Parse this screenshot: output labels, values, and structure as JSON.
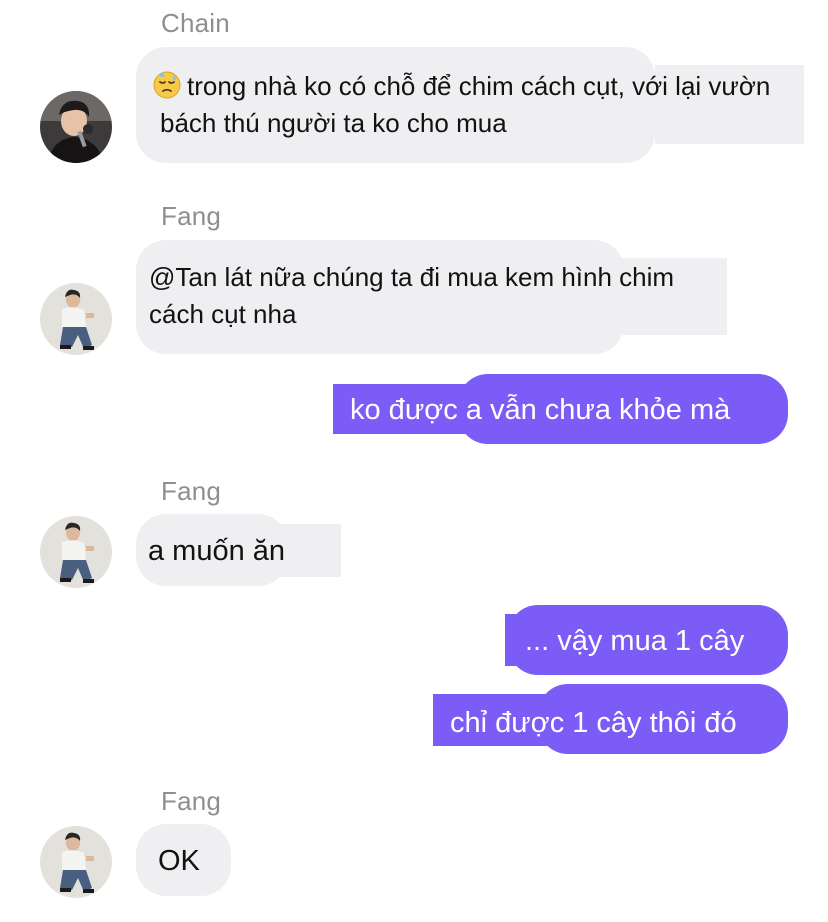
{
  "colors": {
    "incoming_bubble": "#efeff2",
    "outgoing_bubble": "#7b5cf6",
    "sender_name": "#8e8e93",
    "incoming_text": "#121212",
    "outgoing_text": "#ffffff"
  },
  "messages": [
    {
      "sender": "Chain",
      "direction": "incoming",
      "avatar": "chain-avatar",
      "emoji": "downcast-face-with-sweat-icon",
      "lines": [
        "trong nhà ko có chỗ để chim cách cụt, với lại vườn",
        "bách thú người ta ko cho mua"
      ]
    },
    {
      "sender": "Fang",
      "direction": "incoming",
      "avatar": "fang-avatar",
      "lines": [
        "@Tan lát nữa chúng ta đi mua kem hình chim",
        "cách cụt nha"
      ]
    },
    {
      "direction": "outgoing",
      "text": "ko được a vẫn chưa khỏe mà"
    },
    {
      "sender": "Fang",
      "direction": "incoming",
      "avatar": "fang-avatar",
      "text": "a muốn ăn"
    },
    {
      "direction": "outgoing",
      "text": "... vậy mua 1 cây"
    },
    {
      "direction": "outgoing",
      "text": "chỉ được 1 cây thôi đó"
    },
    {
      "sender": "Fang",
      "direction": "incoming",
      "avatar": "fang-avatar",
      "text": "OK"
    }
  ]
}
